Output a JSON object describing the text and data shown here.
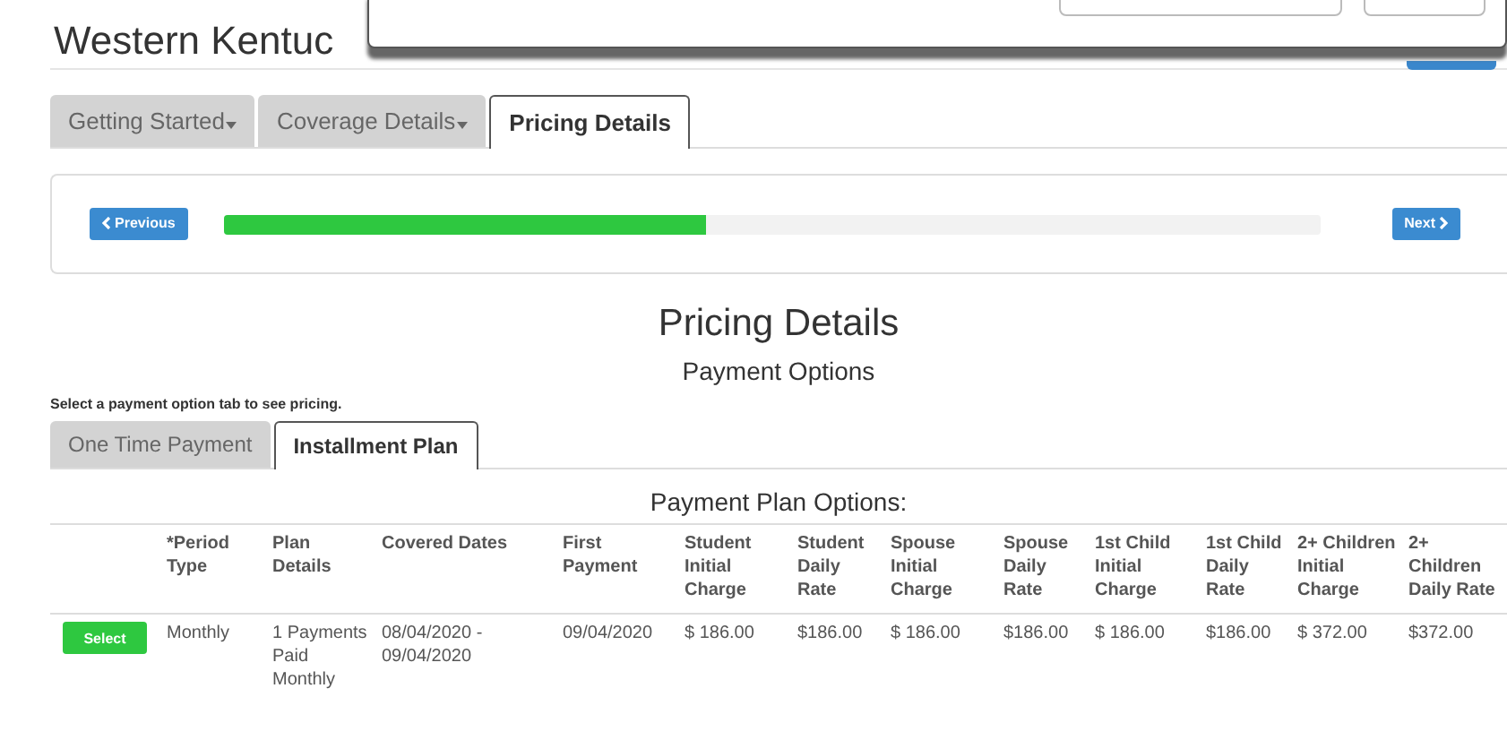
{
  "page_title": "Western Kentuc",
  "steps": [
    {
      "label": "Getting Started",
      "dropdown": true,
      "selected": false
    },
    {
      "label": "Coverage Details",
      "dropdown": true,
      "selected": false
    },
    {
      "label": "Pricing Details",
      "dropdown": false,
      "selected": true
    }
  ],
  "progress": {
    "previous": "Previous",
    "next": "Next",
    "level": 0.44
  },
  "heading": "Pricing Details",
  "subheading": "Payment Options",
  "instruction": "Select a payment option tab to see pricing.",
  "payment_tabs": [
    {
      "label": "One Time Payment",
      "selected": false
    },
    {
      "label": "Installment Plan",
      "selected": true
    }
  ],
  "table": {
    "title": "Payment Plan Options:",
    "columns": [
      "",
      "*Period Type",
      "Plan Details",
      "Covered Dates",
      "First Payment",
      "Student Initial Charge",
      "Student Daily Rate",
      "Spouse Initial Charge",
      "Spouse Daily Rate",
      "1st Child Initial Charge",
      "1st Child Daily Rate",
      "2+ Children Initial Charge",
      "2+ Children Daily Rate"
    ],
    "rows": [
      {
        "cells": [
          {
            "kind": "button",
            "label": "Select"
          },
          "Monthly",
          "1 Payments Paid Monthly",
          "08/04/2020 - 09/04/2020",
          "09/04/2020",
          "$ 186.00",
          "$186.00",
          "$ 186.00",
          "$186.00",
          "$ 186.00",
          "$186.00",
          "$ 372.00",
          "$372.00"
        ]
      }
    ]
  }
}
